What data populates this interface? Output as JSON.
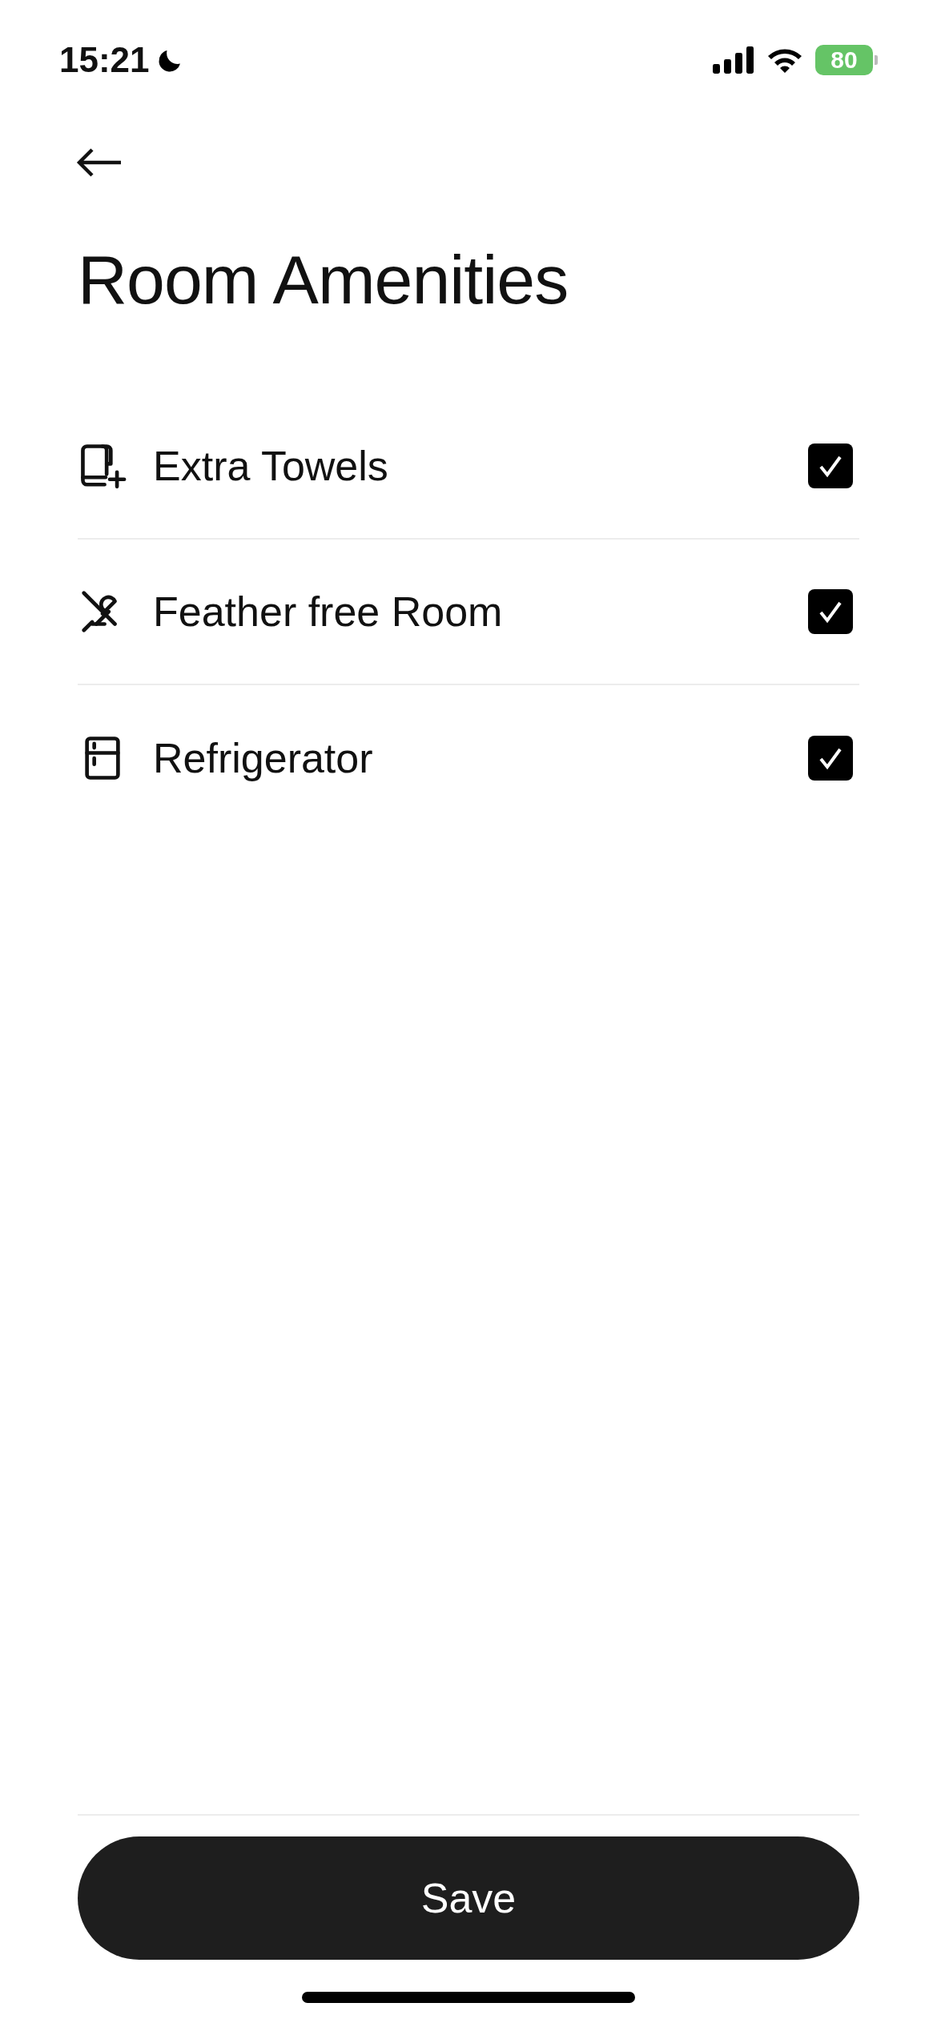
{
  "status_bar": {
    "time": "15:21",
    "battery": "80"
  },
  "title": "Room Amenities",
  "amenities": [
    {
      "kind": "towel",
      "label": "Extra Towels",
      "checked": true
    },
    {
      "kind": "no-feather",
      "label": "Feather free Room",
      "checked": true
    },
    {
      "kind": "fridge",
      "label": "Refrigerator",
      "checked": true
    }
  ],
  "save_button": "Save"
}
